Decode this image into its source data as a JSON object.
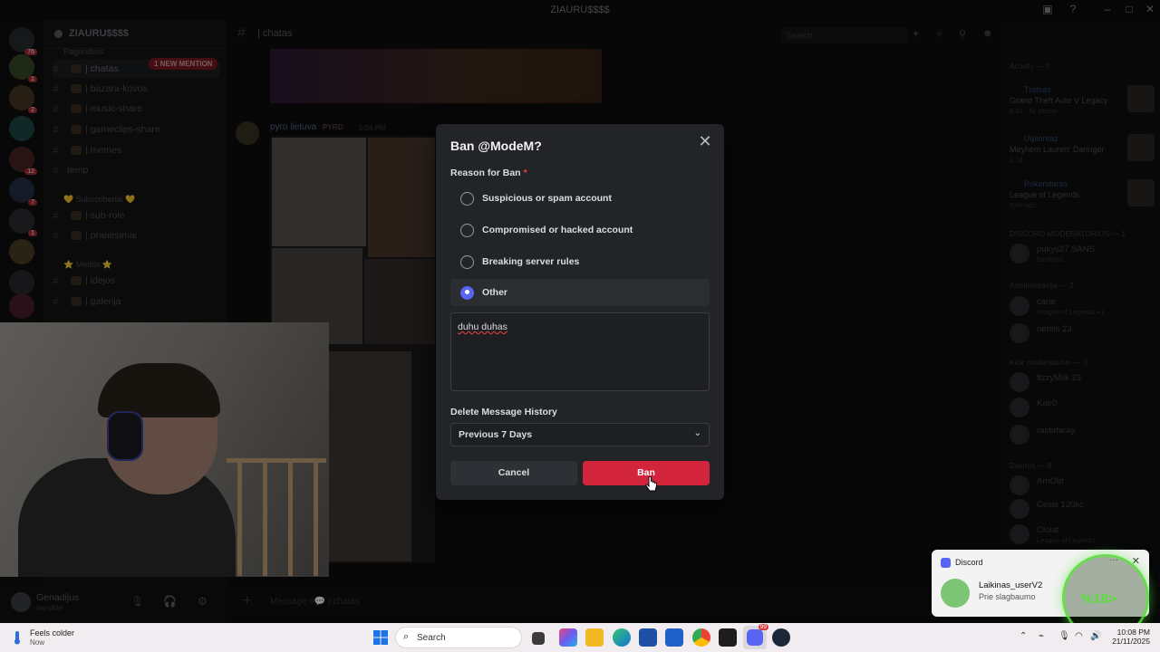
{
  "window": {
    "title": "ZIAURU$$$$"
  },
  "guild": {
    "name": "ZIAURU$$$$",
    "new_mention": "1 NEW MENTION",
    "categories": [
      {
        "label": "Pagrindinis"
      },
      {
        "label": "💛 Subscriberiai 💛"
      },
      {
        "label": "⭐ Medija ⭐"
      }
    ],
    "channels": [
      {
        "label": "| chatas"
      },
      {
        "label": "| bazara-kovos"
      },
      {
        "label": "| music-share"
      },
      {
        "label": "| gameclips-share"
      },
      {
        "label": "| memes"
      },
      {
        "label": "temp"
      },
      {
        "label": "| sub-role"
      },
      {
        "label": "| pranesimai"
      },
      {
        "label": "| idejos"
      },
      {
        "label": "| galerija"
      }
    ]
  },
  "user_panel": {
    "name": "Genadijus",
    "status": "Invisible"
  },
  "chat": {
    "channel_name": "| chatas",
    "search_placeholder": "Search",
    "message": {
      "author": "pyro lietuva",
      "tag": "PYRO",
      "time": "5:04 PM"
    },
    "composer_placeholder": "Message #💬 | chatas"
  },
  "members": {
    "activity_header": "Activity — 5",
    "activities": [
      {
        "user": "Trobias",
        "game": "Grand Theft Auto V Legacy",
        "time": "6:52 · 5x Streak"
      },
      {
        "user": "Ulpiontaz",
        "game": "Meyhem Lauren; Daringer",
        "time": "1:18"
      },
      {
        "user": "Pokerstaras",
        "game": "League of Legends",
        "time": "53m ago"
      }
    ],
    "sections": [
      {
        "label": "DISCORD MODERATORIUS — 1"
      },
      {
        "label": "Administracija — 2"
      },
      {
        "label": "Kick moderatorius — 3"
      },
      {
        "label": "Ziaurus — 8"
      }
    ],
    "people": [
      {
        "name": "pukys27",
        "badge": "SANS",
        "sub": "banFistis"
      },
      {
        "name": "cane",
        "badge": "",
        "sub": "League of Legends +1"
      },
      {
        "name": "netels",
        "badge": "23",
        "sub": ""
      },
      {
        "name": "fizzyMilk",
        "badge": "23",
        "sub": ""
      },
      {
        "name": "Kair0",
        "badge": "",
        "sub": ""
      },
      {
        "name": "rastafaray",
        "badge": "",
        "sub": ""
      },
      {
        "name": "ArnOld",
        "badge": "",
        "sub": ""
      },
      {
        "name": "Cesis",
        "badge": "120kc",
        "sub": ""
      },
      {
        "name": "Clolat",
        "badge": "",
        "sub": "League of Legends"
      }
    ]
  },
  "modal": {
    "title": "Ban @ModeM?",
    "reason_label": "Reason for Ban",
    "required_mark": "*",
    "reasons": [
      {
        "label": "Suspicious or spam account",
        "selected": false
      },
      {
        "label": "Compromised or hacked account",
        "selected": false
      },
      {
        "label": "Breaking server rules",
        "selected": false
      },
      {
        "label": "Other",
        "selected": true
      }
    ],
    "other_text": "duhu duhas",
    "history_label": "Delete Message History",
    "history_value": "Previous 7 Days",
    "cancel_label": "Cancel",
    "ban_label": "Ban",
    "colors": {
      "ban": "#d2253c",
      "accent": "#5865f2"
    }
  },
  "toast": {
    "app": "Discord",
    "title": "Laikinas_userV2",
    "body": "Prie slagbaumo"
  },
  "overlay_meter": {
    "text": "%18>"
  },
  "taskbar": {
    "weather_title": "Feels colder",
    "weather_sub": "Now",
    "search_label": "Search",
    "time": "10:08 PM",
    "date": "21/11/2025",
    "discord_badge": "99"
  }
}
